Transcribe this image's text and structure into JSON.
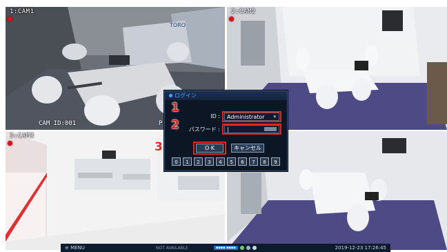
{
  "cameras": [
    {
      "label": "1:CAM1",
      "osd_left": "CAM ID:001",
      "osd_right": "P:",
      "sign": "TORO"
    },
    {
      "label": "2:CAM2"
    },
    {
      "label": "3:CAM3"
    },
    {
      "label": ""
    }
  ],
  "taskbar": {
    "menu_label": "≡  MENU",
    "availability": "NOT AVAILABLE",
    "status_badge": "▪▪▪▪ ▪▪▪▪",
    "datetime": "2019-12-23 17:26:45"
  },
  "login_dialog": {
    "title": "ログイン",
    "id_label": "ID :",
    "id_value": "Administrator",
    "id_caret": "▾",
    "password_label": "パスワード :",
    "password_value": "|",
    "ok_label": "O K",
    "cancel_label": "キャンセル",
    "keypad": [
      "0",
      "1",
      "2",
      "3",
      "4",
      "5",
      "6",
      "7",
      "8",
      "9"
    ]
  },
  "steps": [
    "1",
    "2",
    "3"
  ],
  "colors": {
    "highlight": "#e8261f",
    "dialog_bg": "#0c1624",
    "title_text": "#4da3ff"
  }
}
